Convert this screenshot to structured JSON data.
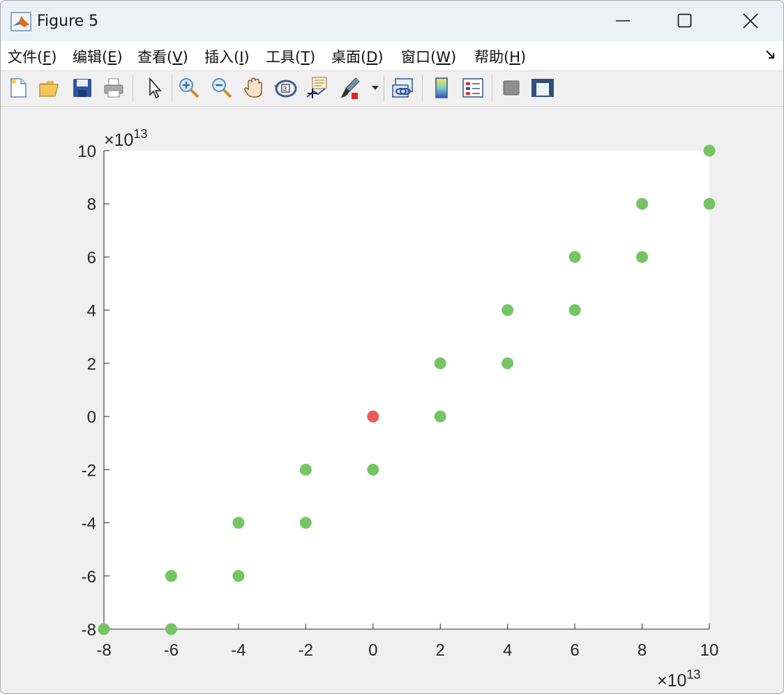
{
  "window": {
    "title": "Figure 5",
    "controls": {
      "minimize": "minimize",
      "maximize": "maximize",
      "close": "close"
    }
  },
  "menu": [
    {
      "label": "文件(",
      "key": "F",
      "tail": ")"
    },
    {
      "label": "编辑(",
      "key": "E",
      "tail": ")"
    },
    {
      "label": "查看(",
      "key": "V",
      "tail": ")"
    },
    {
      "label": "插入(",
      "key": "I",
      "tail": ")"
    },
    {
      "label": "工具(",
      "key": "T",
      "tail": ")"
    },
    {
      "label": "桌面(",
      "key": "D",
      "tail": ")"
    },
    {
      "label": "窗口(",
      "key": "W",
      "tail": ")"
    },
    {
      "label": "帮助(",
      "key": "H",
      "tail": ")"
    }
  ],
  "toolbar": {
    "icons": [
      "new-figure-icon",
      "open-file-icon",
      "save-icon",
      "print-icon",
      "pointer-icon",
      "zoom-in-icon",
      "zoom-out-icon",
      "pan-hand-icon",
      "rotate-3d-icon",
      "data-cursor-icon",
      "brush-icon",
      "brush-dropdown-icon",
      "link-plot-icon",
      "colorbar-icon",
      "legend-icon",
      "hide-plot-tools-icon",
      "show-plot-tools-icon"
    ]
  },
  "colors": {
    "point": "#77c465",
    "highlight": "#eb5a5a",
    "axes_bg": "#ffffff",
    "figure_bg": "#f0f0f0"
  },
  "chart_data": {
    "type": "scatter",
    "xlim": [
      -8,
      10
    ],
    "ylim": [
      -8,
      10
    ],
    "x_ticks": [
      -8,
      -6,
      -4,
      -2,
      0,
      2,
      4,
      6,
      8,
      10
    ],
    "y_ticks": [
      -8,
      -6,
      -4,
      -2,
      0,
      2,
      4,
      6,
      8,
      10
    ],
    "x_tick_labels": [
      "-8",
      "-6",
      "-4",
      "-2",
      "0",
      "2",
      "4",
      "6",
      "8",
      "10"
    ],
    "y_tick_labels": [
      "-8",
      "-6",
      "-4",
      "-2",
      "0",
      "2",
      "4",
      "6",
      "8",
      "10"
    ],
    "x_exponent_base": "×10",
    "x_exponent_power": "13",
    "y_exponent_base": "×10",
    "y_exponent_power": "13",
    "grid": false,
    "series": [
      {
        "color": "#77c465",
        "points": [
          [
            -8,
            -8
          ],
          [
            -6,
            -8
          ],
          [
            -6,
            -6
          ],
          [
            -4,
            -6
          ],
          [
            -4,
            -4
          ],
          [
            -2,
            -4
          ],
          [
            -2,
            -2
          ],
          [
            0,
            -2
          ],
          [
            2,
            0
          ],
          [
            2,
            2
          ],
          [
            4,
            2
          ],
          [
            4,
            4
          ],
          [
            6,
            4
          ],
          [
            6,
            6
          ],
          [
            8,
            6
          ],
          [
            8,
            8
          ],
          [
            10,
            8
          ],
          [
            10,
            10
          ]
        ]
      },
      {
        "color": "#eb5a5a",
        "points": [
          [
            0,
            0
          ]
        ]
      }
    ]
  }
}
